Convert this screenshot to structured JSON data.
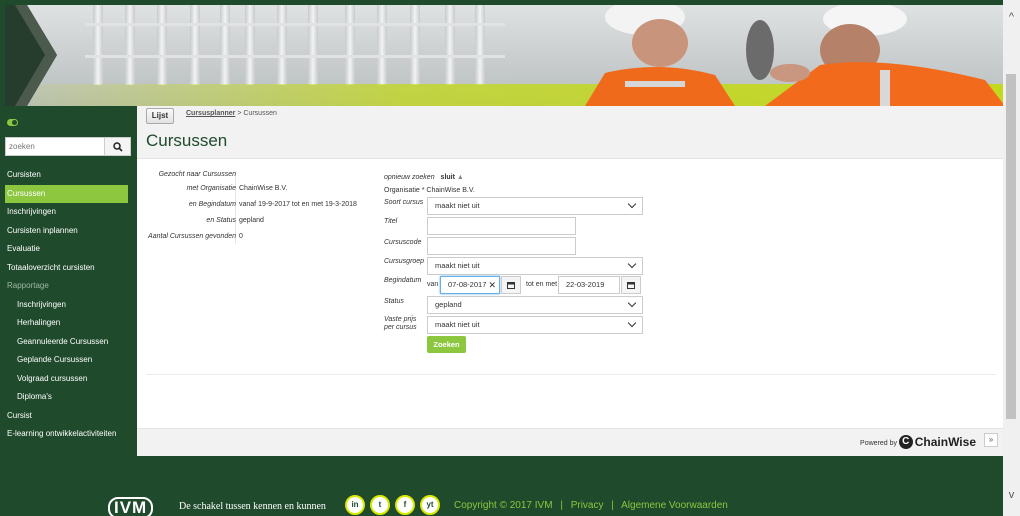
{
  "sidebar": {
    "search_placeholder": "zoeken",
    "items": [
      {
        "label": "Cursisten",
        "active": false,
        "sub": false
      },
      {
        "label": "Cursussen",
        "active": true,
        "sub": false
      },
      {
        "label": "Inschrijvingen",
        "active": false,
        "sub": false
      },
      {
        "label": "Cursisten inplannen",
        "active": false,
        "sub": false
      },
      {
        "label": "Evaluatie",
        "active": false,
        "sub": false
      },
      {
        "label": "Totaaloverzicht cursisten",
        "active": false,
        "sub": false
      },
      {
        "label": "Rapportage",
        "active": false,
        "sub": false
      },
      {
        "label": "Inschrijvingen",
        "active": false,
        "sub": true
      },
      {
        "label": "Herhalingen",
        "active": false,
        "sub": true
      },
      {
        "label": "Geannuleerde Cursussen",
        "active": false,
        "sub": true
      },
      {
        "label": "Geplande Cursussen",
        "active": false,
        "sub": true
      },
      {
        "label": "Volgraad cursussen",
        "active": false,
        "sub": true
      },
      {
        "label": "Diploma's",
        "active": false,
        "sub": true
      },
      {
        "label": "Cursist",
        "active": false,
        "sub": false
      },
      {
        "label": "E-learning ontwikkelactiviteiten",
        "active": false,
        "sub": false
      }
    ]
  },
  "toolbar": {
    "lijst_label": "Lijst"
  },
  "breadcrumb": {
    "link": "Cursusplanner",
    "separator": " > ",
    "current": "Cursussen"
  },
  "page_title": "Cursussen",
  "summary": {
    "rows": [
      {
        "label": "Gezocht naar Cursussen",
        "value": ""
      },
      {
        "label": "met Organisatie",
        "value": "ChainWise B.V."
      },
      {
        "label": "en Begindatum",
        "value": "vanaf 19-9-2017 tot en met 19-3-2018"
      },
      {
        "label": "en Status",
        "value": "gepland"
      },
      {
        "label": "Aantal Cursussen gevonden",
        "value": "0"
      }
    ]
  },
  "search_form": {
    "restart_label": "opnieuw zoeken",
    "close_label": "sluit",
    "close_arrow": "▲",
    "organisatie_label": "Organisatie *",
    "organisatie_value": "ChainWise B.V.",
    "soort_label": "Soort cursus",
    "soort_value": "maakt niet uit",
    "titel_label": "Titel",
    "titel_value": "",
    "code_label": "Cursuscode",
    "code_value": "",
    "groep_label": "Cursusgroep",
    "groep_value": "maakt niet uit",
    "begindatum_label": "Begindatum",
    "van_label": "van",
    "van_value": "07-08-2017",
    "tot_label": "tot en met",
    "tot_value": "22-03-2019",
    "status_label": "Status",
    "status_value": "gepland",
    "prijs_label": "Vaste prijs per cursus",
    "prijs_value": "maakt niet uit",
    "submit_label": "Zoeken"
  },
  "powered": {
    "label": "Powered by",
    "brand": "ChainWise",
    "collapse": "»"
  },
  "footer": {
    "logo": "IVM",
    "tagline": "De schakel tussen kennen en kunnen",
    "social": [
      "in",
      "t",
      "f",
      "yt"
    ],
    "links": [
      "Copyright © 2017 IVM",
      "|",
      "Privacy",
      "|",
      "Algemene Voorwaarden"
    ]
  },
  "colors": {
    "brand_green": "#1f4a2c",
    "accent": "#8dc63f"
  }
}
